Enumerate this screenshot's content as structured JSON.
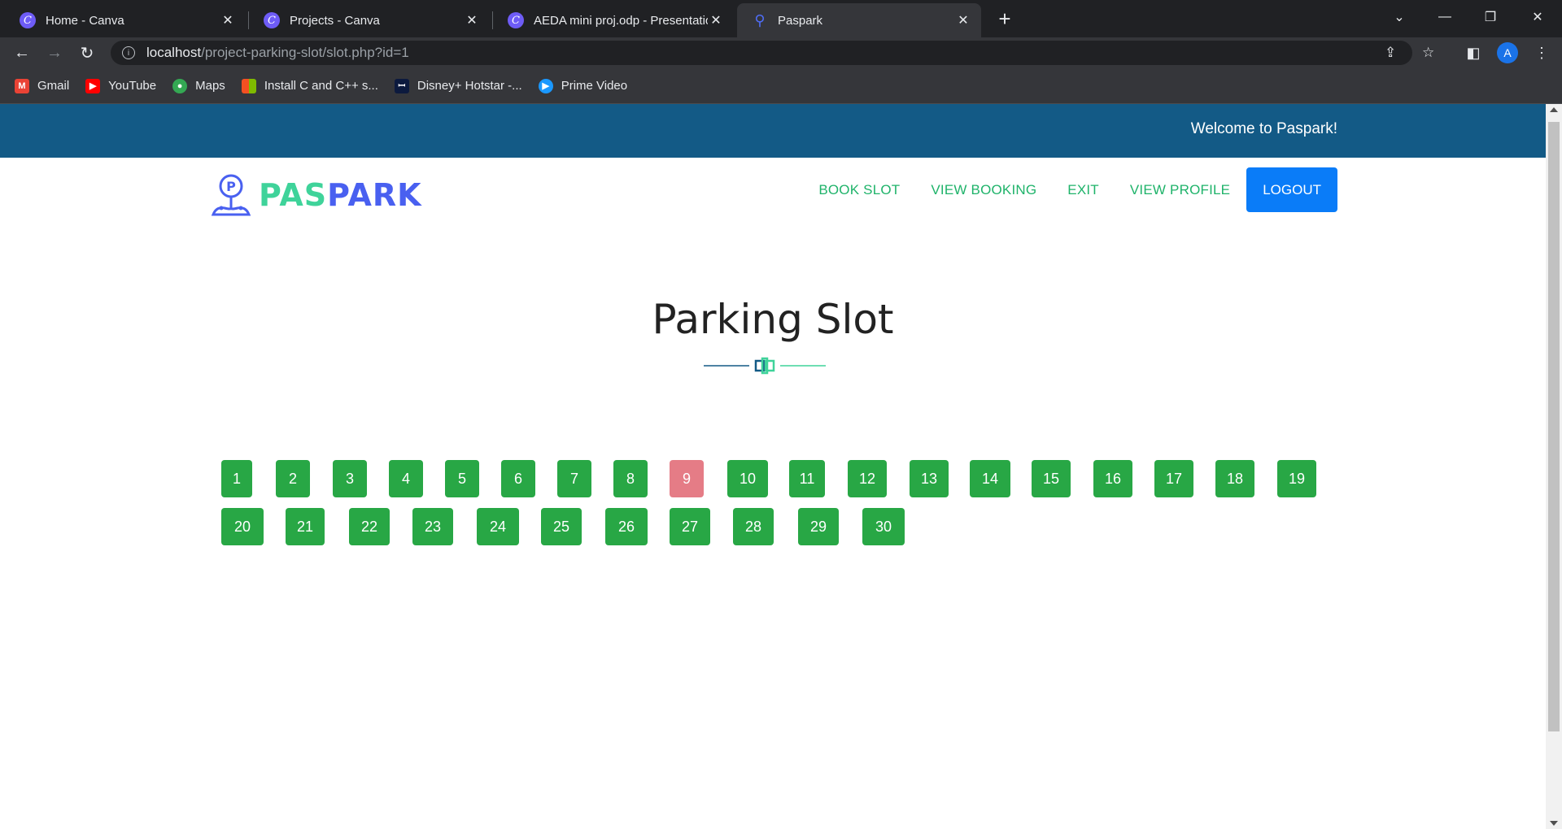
{
  "browser": {
    "tabs": [
      {
        "title": "Home - Canva",
        "icon": "canva-icon",
        "active": false
      },
      {
        "title": "Projects - Canva",
        "icon": "canva-icon",
        "active": false
      },
      {
        "title": "AEDA mini proj.odp - Presentatio",
        "icon": "canva-icon",
        "active": false
      },
      {
        "title": "Paspark",
        "icon": "map-pin-icon",
        "active": true
      }
    ],
    "url_host": "localhost",
    "url_path": "/project-parking-slot/slot.php?id=1",
    "profile_initial": "A",
    "bookmarks": [
      {
        "label": "Gmail",
        "icon": "gmail-icon",
        "color": "#ea4335"
      },
      {
        "label": "YouTube",
        "icon": "youtube-icon",
        "color": "#ff0000"
      },
      {
        "label": "Maps",
        "icon": "maps-icon",
        "color": "#34a853"
      },
      {
        "label": "Install C and C++ s...",
        "icon": "microsoft-icon",
        "color": "#f25022"
      },
      {
        "label": "Disney+ Hotstar -...",
        "icon": "hotstar-icon",
        "color": "#0c1a3e"
      },
      {
        "label": "Prime Video",
        "icon": "prime-video-icon",
        "color": "#1a98ff"
      }
    ]
  },
  "header": {
    "welcome": "Welcome to Paspark!",
    "logo_pas": "PAS",
    "logo_park": "PARK",
    "logo_pin_letter": "P",
    "nav": {
      "book_slot": "BOOK SLOT",
      "view_booking": "VIEW BOOKING",
      "exit": "EXIT",
      "view_profile": "VIEW PROFILE",
      "logout": "LOGOUT"
    }
  },
  "main": {
    "title": "Parking Slot",
    "slots_row1": [
      "1",
      "2",
      "3",
      "4",
      "5",
      "6",
      "7",
      "8",
      "9",
      "10",
      "11",
      "12",
      "13",
      "14",
      "15",
      "16",
      "17",
      "18",
      "19"
    ],
    "slots_row2": [
      "20",
      "21",
      "22",
      "23",
      "24",
      "25",
      "26",
      "27",
      "28",
      "29",
      "30"
    ],
    "booked_slots": [
      "9"
    ]
  },
  "colors": {
    "available": "#28a745",
    "booked": "#e57c86",
    "topbar": "#135a86",
    "nav_link": "#1fb36a",
    "logout": "#0a7cf8"
  }
}
